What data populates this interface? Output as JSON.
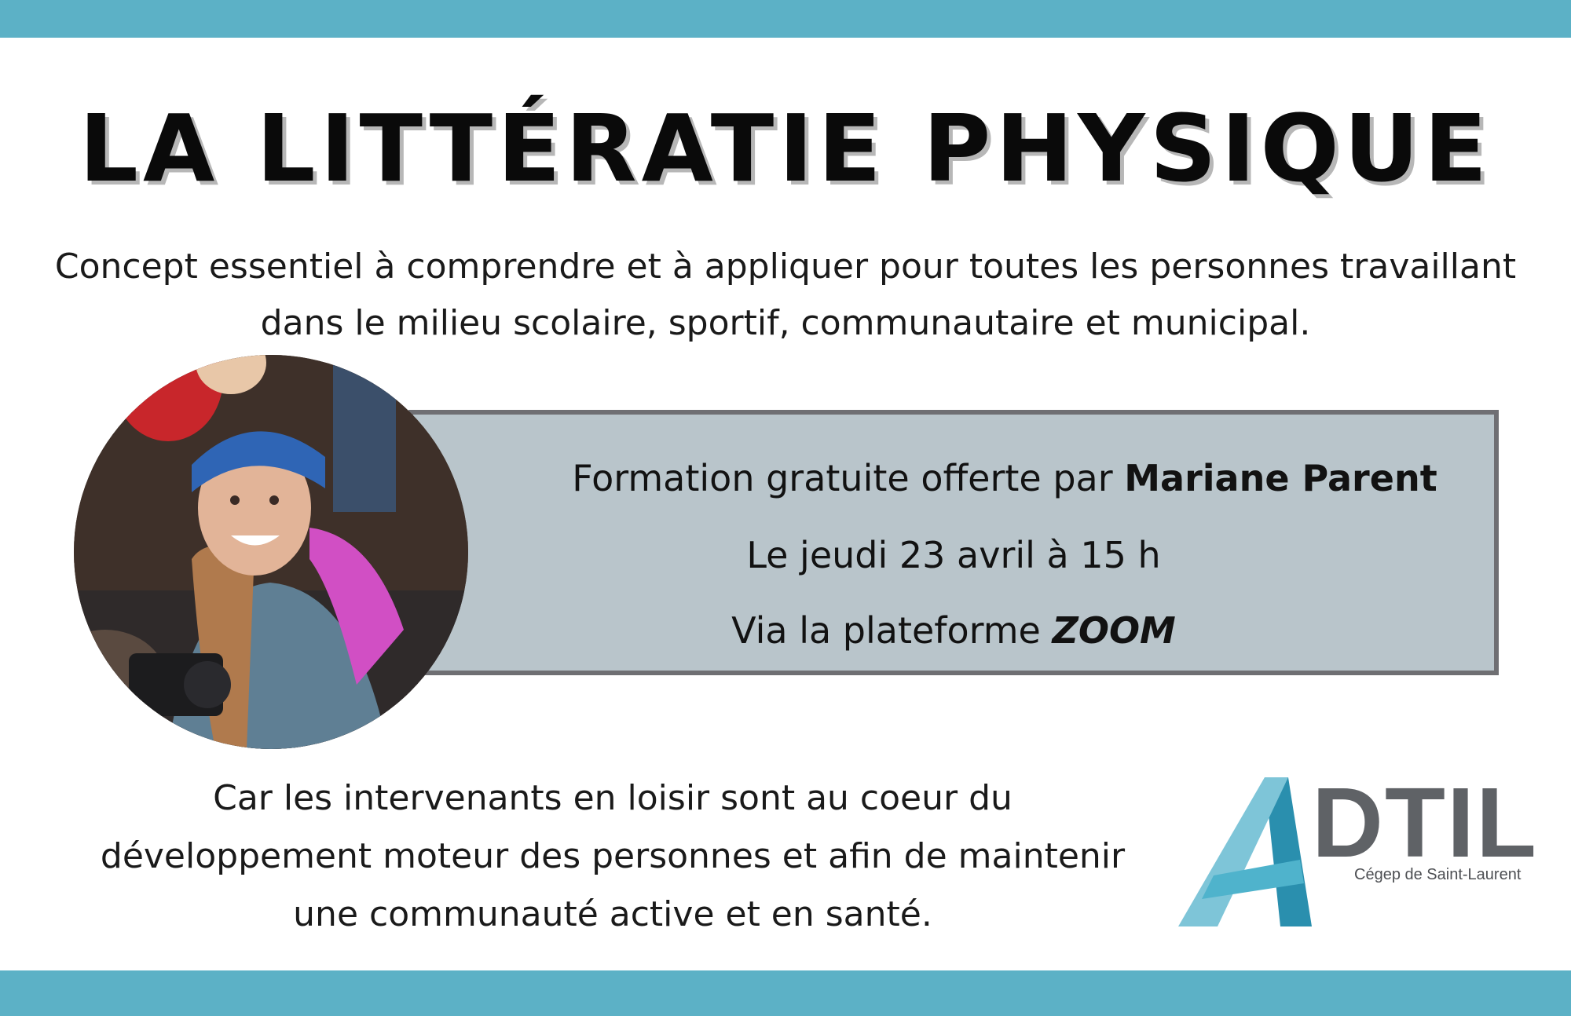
{
  "header": {
    "title": "LA LITTÉRATIE PHYSIQUE",
    "subtitle_line1": "Concept essentiel à comprendre et à appliquer pour toutes les personnes travaillant",
    "subtitle_line2": "dans le milieu scolaire, sportif, communautaire et municipal."
  },
  "info": {
    "line1_prefix": "Formation gratuite offerte par ",
    "presenter": "Mariane Parent",
    "date": "Le jeudi 23 avril à 15 h",
    "platform_prefix": "Via la plateforme ",
    "platform": "ZOOM"
  },
  "closing": {
    "line1": "Car les intervenants en loisir sont au coeur du",
    "line2": "développement moteur des personnes et afin de maintenir",
    "line3": "une communauté active et en santé."
  },
  "logo": {
    "wordmark": "DTIL",
    "institution": "Cégep de Saint-Laurent"
  },
  "colors": {
    "band": "#5cb1c6",
    "info_box": "#b9c5cb",
    "info_border": "#6f6f73"
  }
}
